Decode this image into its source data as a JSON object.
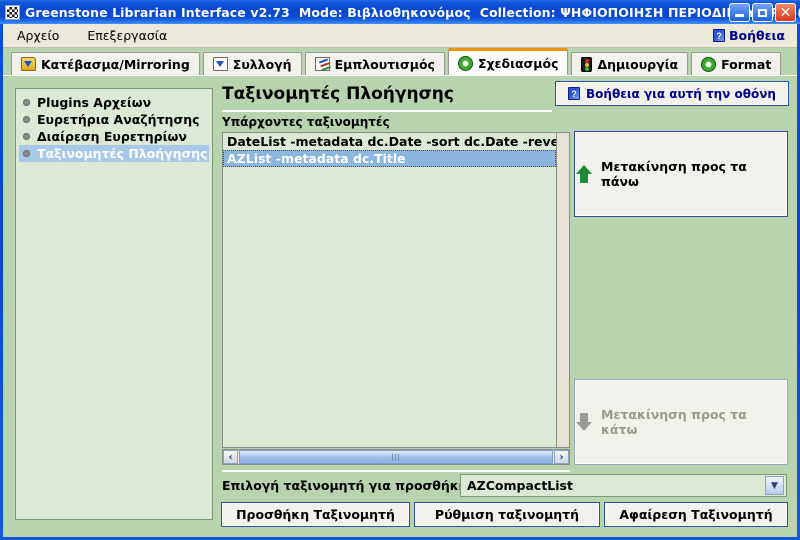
{
  "window": {
    "title_app": "Greenstone Librarian Interface v2.73",
    "title_mode": "Mode: Βιβλιοθηκονόμος",
    "title_collection": "Collection: ΨΗΦΙΟΠΟΙΗΣΗ ΠΕΡΙΟΔΙΚΟΥ ARTI (...",
    "minimize_label": "",
    "maximize_label": "",
    "close_label": "✕",
    "app_icon": "greenstone-icon"
  },
  "menubar": {
    "items": [
      {
        "label": "Αρχείο"
      },
      {
        "label": "Επεξεργασία"
      }
    ],
    "help": {
      "label": "Βοήθεια",
      "icon": "help-book-icon"
    }
  },
  "tabs": [
    {
      "label": "Κατέβασμα/Mirroring",
      "icon": "folder-download-icon",
      "active": false
    },
    {
      "label": "Συλλογή",
      "icon": "page-download-icon",
      "active": false
    },
    {
      "label": "Εμπλουτισμός",
      "icon": "pencil-edit-icon",
      "active": false
    },
    {
      "label": "Σχεδιασμός",
      "icon": "gear-icon",
      "active": true
    },
    {
      "label": "Δημιουργία",
      "icon": "traffic-light-icon",
      "active": false
    },
    {
      "label": "Format",
      "icon": "gear-icon",
      "active": false
    }
  ],
  "sidebar": {
    "items": [
      {
        "label": "Plugins Αρχείων",
        "selected": false
      },
      {
        "label": "Ευρετήρια Αναζήτησης",
        "selected": false
      },
      {
        "label": "Διαίρεση Ευρετηρίων",
        "selected": false
      },
      {
        "label": "Ταξινομητές Πλοήγησης",
        "selected": true
      }
    ]
  },
  "main": {
    "page_title": "Ταξινομητές Πλοήγησης",
    "help_screen_button": {
      "label": "Βοήθεια για αυτή την οθόνη",
      "icon": "help-book-icon"
    },
    "list_label": "Υπάρχοντες ταξινομητές",
    "classifiers": [
      {
        "text": "DateList -metadata dc.Date -sort dc.Date -reverse",
        "selected": false
      },
      {
        "text": "AZList -metadata dc.Title",
        "selected": true
      }
    ],
    "move_up_button": {
      "label": "Μετακίνηση προς τα πάνω",
      "icon": "arrow-up-icon",
      "enabled": true
    },
    "move_down_button": {
      "label": "Μετακίνηση προς τα κάτω",
      "icon": "arrow-down-icon",
      "enabled": false
    },
    "combo_label": "Επιλογή ταξινομητή για προσθήκη:",
    "combo_value": "AZCompactList",
    "buttons": {
      "add": "Προσθήκη Ταξινομητή",
      "configure": "Ρύθμιση ταξινομητή",
      "remove": "Αφαίρεση Ταξινομητή"
    },
    "scrollbar": {
      "left_arrow": "‹",
      "right_arrow": "›"
    }
  },
  "colors": {
    "titlebar_blue": "#0a47cf",
    "panel_green": "#b7d4af",
    "light_green": "#dcead5",
    "accent_orange": "#f0920a",
    "selection_blue": "#8cb6dd",
    "link_navy": "#00008b"
  }
}
